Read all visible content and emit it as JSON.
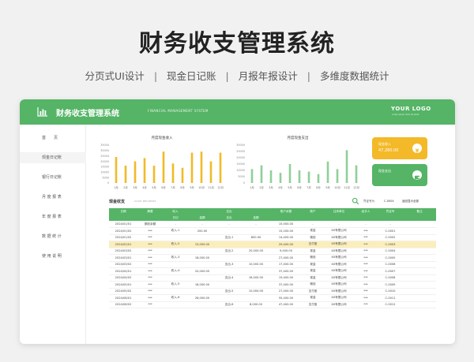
{
  "hero": {
    "title": "财务收支管理系统",
    "subtitles": [
      "分页式UI设计",
      "现金日记账",
      "月报年报设计",
      "多维度数据统计"
    ],
    "separator": "|"
  },
  "topbar": {
    "title": "财务收支管理系统",
    "subtitle": "FINANCIAL MANAGEMENT SYSTEM",
    "logo": "YOUR LOGO",
    "logo_sub": "Lorem ipsum dolor sit amet",
    "icon": "bar-chart-icon"
  },
  "colors": {
    "green": "#55b466",
    "yellow": "#f3b928",
    "bar_yellow": "#f1bb26",
    "bar_green": "#8fd099",
    "highlight": "#fbeeba"
  },
  "sidebar": {
    "items": [
      {
        "label": "首　　页"
      },
      {
        "label": "现金日记账"
      },
      {
        "label": "银行日记账"
      },
      {
        "label": "月 度 报 表"
      },
      {
        "label": "年 度 报 表"
      },
      {
        "label": "数 据 统 计"
      },
      {
        "label": "使 用 说 明"
      }
    ],
    "active_index": 1
  },
  "charts": {
    "income": {
      "title": "月度现金收入"
    },
    "expense": {
      "title": "月度现金支出"
    }
  },
  "chart_data": [
    {
      "type": "bar",
      "title": "月度现金收入",
      "categories": [
        "1月",
        "2月",
        "3月",
        "4月",
        "5月",
        "6月",
        "7月",
        "8月",
        "9月",
        "10月",
        "11月",
        "12月"
      ],
      "values": [
        24000,
        16000,
        20000,
        23000,
        16000,
        29000,
        18000,
        14000,
        28000,
        29000,
        20000,
        28000
      ],
      "ylim": [
        0,
        35000
      ],
      "yticks": [
        0,
        5000,
        10000,
        15000,
        20000,
        25000,
        30000,
        35000
      ],
      "grid": false
    },
    {
      "type": "bar",
      "title": "月度现金支出",
      "categories": [
        "1月",
        "2月",
        "3月",
        "4月",
        "5月",
        "6月",
        "7月",
        "8月",
        "9月",
        "10月",
        "11月",
        "12月"
      ],
      "values": [
        11000,
        14000,
        10000,
        8000,
        15000,
        10000,
        9000,
        7000,
        17000,
        11000,
        26000,
        14000
      ],
      "ylim": [
        0,
        30000
      ],
      "yticks": [
        0,
        5000,
        10000,
        15000,
        20000,
        25000,
        30000
      ],
      "grid": false
    }
  ],
  "cards": [
    {
      "label": "现金收入",
      "value": "47,280.00",
      "color": "#f3b928",
      "icon": "yuan-coin-icon"
    },
    {
      "label": "现金支出",
      "value": "",
      "color": "#55b466",
      "icon": "wallet-icon"
    }
  ],
  "section": {
    "title": "现金收支",
    "title_en": "CASH RECORDS",
    "filter_label": "凭证号为",
    "filter_value": "C-0004",
    "filter_link": "返回显示全部"
  },
  "table": {
    "headers_top": [
      "日期",
      "摘要",
      "收入",
      "",
      "支出",
      "",
      "账户余额",
      "账户",
      "往来单位",
      "经手人",
      "凭证号",
      "备注"
    ],
    "headers_sub": [
      "",
      "",
      "日记",
      "金额",
      "支出",
      "金额",
      "",
      "",
      "",
      "",
      "",
      ""
    ],
    "rows": [
      [
        "2024/01/01",
        "期初余额",
        "-",
        "-",
        "-",
        "-",
        "15,000.00",
        "-",
        "-",
        "-",
        "-",
        ""
      ],
      [
        "2024/01/02",
        "***",
        "收入-1",
        "200.00",
        "",
        "",
        "15,200.00",
        "现金",
        "XX有限公司",
        "***",
        "C-0001",
        ""
      ],
      [
        "2024/01/02",
        "***",
        "",
        "",
        "支出-1",
        "800.00",
        "14,400.00",
        "微信",
        "XX有限公司",
        "***",
        "C-0002",
        ""
      ],
      [
        "2024/02/01",
        "***",
        "收入-2",
        "15,000.00",
        "",
        "",
        "29,400.00",
        "支付宝",
        "XX有限公司",
        "***",
        "C-0003",
        ""
      ],
      [
        "2024/03/02",
        "***",
        "",
        "",
        "支出-2",
        "20,000.00",
        "9,400.00",
        "现金",
        "XX有限公司",
        "***",
        "C-0004",
        ""
      ],
      [
        "2024/03/01",
        "***",
        "收入-3",
        "18,000.00",
        "",
        "",
        "27,400.00",
        "微信",
        "XX有限公司",
        "***",
        "C-0005",
        ""
      ],
      [
        "2024/03/02",
        "***",
        "",
        "",
        "支出-3",
        "10,000.00",
        "17,400.00",
        "现金",
        "XX有限公司",
        "***",
        "C-0006",
        ""
      ],
      [
        "2024/04/01",
        "***",
        "收入-4",
        "20,000.00",
        "",
        "",
        "37,400.00",
        "现金",
        "XX有限公司",
        "***",
        "C-0007",
        ""
      ],
      [
        "2024/04/02",
        "***",
        "",
        "",
        "支出-4",
        "18,000.00",
        "19,400.00",
        "现金",
        "XX有限公司",
        "***",
        "C-0008",
        ""
      ],
      [
        "2024/05/01",
        "***",
        "收入-5",
        "18,000.00",
        "",
        "",
        "37,400.00",
        "微信",
        "XX有限公司",
        "***",
        "C-0009",
        ""
      ],
      [
        "2024/05/02",
        "***",
        "",
        "",
        "支出-5",
        "10,000.00",
        "27,400.00",
        "支付宝",
        "XX有限公司",
        "***",
        "C-0010",
        ""
      ],
      [
        "2024/06/01",
        "***",
        "收入-6",
        "28,000.00",
        "",
        "",
        "55,400.00",
        "现金",
        "XX有限公司",
        "***",
        "C-0011",
        ""
      ],
      [
        "2024/06/02",
        "***",
        "",
        "",
        "支出-6",
        "8,000.00",
        "47,400.00",
        "支付宝",
        "XX有限公司",
        "***",
        "C-0012",
        ""
      ]
    ],
    "highlight_row": 3
  }
}
